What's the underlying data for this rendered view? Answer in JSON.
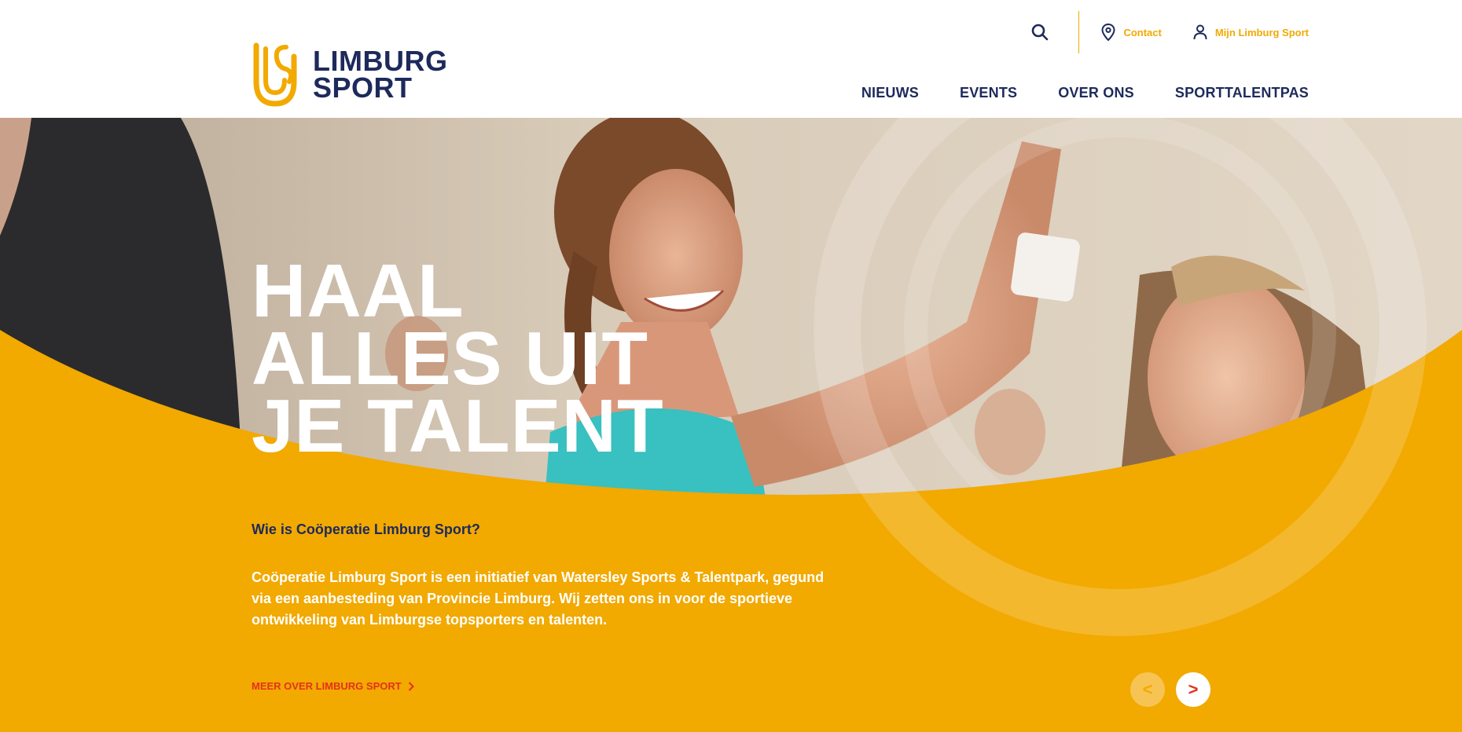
{
  "header": {
    "logo_line1": "LIMBURG",
    "logo_line2": "SPORT",
    "utility": {
      "contact_label": "Contact",
      "account_label": "Mijn Limburg Sport"
    },
    "nav": [
      {
        "label": "NIEUWS"
      },
      {
        "label": "EVENTS"
      },
      {
        "label": "OVER ONS"
      },
      {
        "label": "SPORTTALENTPAS"
      }
    ]
  },
  "hero": {
    "headline_lines": [
      "HAAL",
      "ALLES UIT",
      "JE TALENT"
    ],
    "subtitle": "Wie is Coöperatie Limburg Sport?",
    "body": "Coöperatie Limburg Sport is een initiatief van Watersley Sports & Talentpark, gegund via een aanbesteding van Provincie Limburg. Wij zetten ons in voor de sportieve ontwikkeling van Limburgse topsporters en talenten.",
    "more_link": "MEER OVER LIMBURG SPORT",
    "prev_label": "<",
    "next_label": ">"
  },
  "colors": {
    "brand_yellow": "#f2a900",
    "brand_navy": "#1d2a5b",
    "accent_red": "#e3321e",
    "white": "#ffffff"
  },
  "icons": {
    "search": "search-icon",
    "contact": "location-pin-icon",
    "account": "user-icon",
    "more": "chevron-right-icon"
  }
}
